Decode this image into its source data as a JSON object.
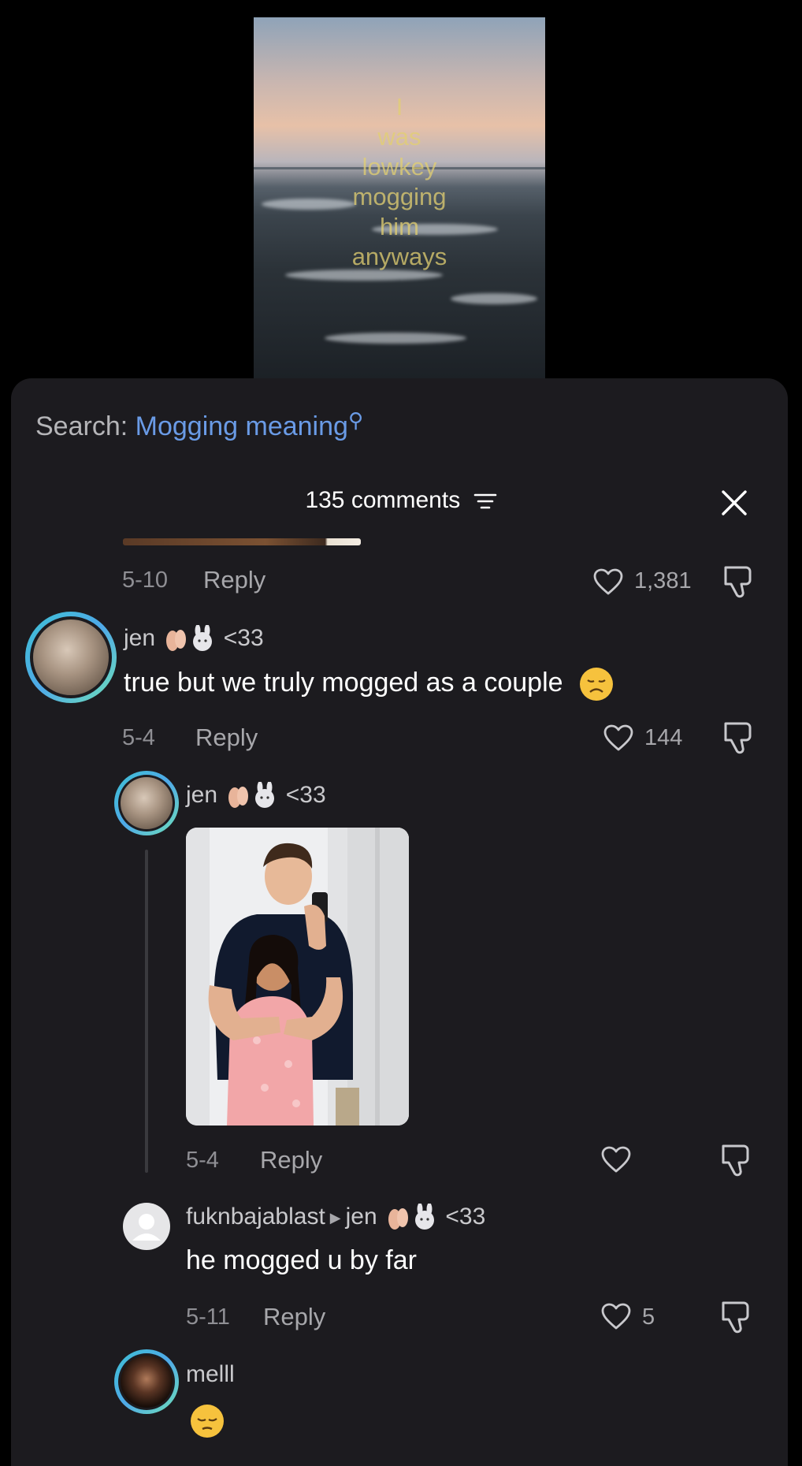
{
  "video": {
    "caption_lines": [
      "I",
      "was",
      "lowkey",
      "mogging",
      "him",
      "anyways"
    ]
  },
  "search": {
    "prefix": "Search:",
    "query": "Mogging meaning"
  },
  "header": {
    "title": "135 comments"
  },
  "comments": [
    {
      "date": "5-10",
      "reply_label": "Reply",
      "likes": "1,381"
    },
    {
      "username": "jen",
      "badge_text": "<33",
      "text": "true but we truly mogged as a couple",
      "date": "5-4",
      "reply_label": "Reply",
      "likes": "144"
    },
    {
      "username": "jen",
      "badge_text": "<33",
      "has_photo": true,
      "date": "5-4",
      "reply_label": "Reply",
      "likes": ""
    },
    {
      "username": "fuknbajablast",
      "reply_to": "jen",
      "badge_text": "<33",
      "text": "he mogged u by far",
      "date": "5-11",
      "reply_label": "Reply",
      "likes": "5"
    },
    {
      "username": "melll"
    }
  ],
  "colors": {
    "sheet_bg": "#1c1b1f",
    "accent_blue": "#6a9be6",
    "avatar_ring": "#3ec1d3"
  }
}
